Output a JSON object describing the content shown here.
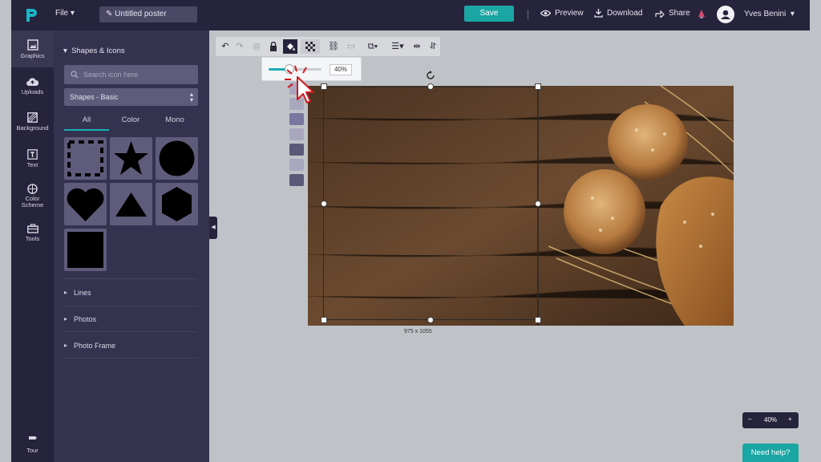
{
  "app": {
    "file_menu": "File",
    "title": "Untitled poster",
    "save": "Save",
    "preview": "Preview",
    "download": "Download",
    "share": "Share",
    "user": "Yves Benini"
  },
  "rail": [
    {
      "label": "Graphics",
      "icon": "graphics-icon"
    },
    {
      "label": "Uploads",
      "icon": "cloud-upload-icon"
    },
    {
      "label": "Background",
      "icon": "background-icon"
    },
    {
      "label": "Text",
      "icon": "text-icon"
    },
    {
      "label": "Color Scheme",
      "icon": "palette-icon"
    },
    {
      "label": "Tools",
      "icon": "toolbox-icon"
    },
    {
      "label": "Tour",
      "icon": "tour-icon"
    }
  ],
  "panel": {
    "heading": "Shapes & Icons",
    "search_placeholder": "Search icon here",
    "select_value": "Shapes - Basic",
    "tabs": [
      "All",
      "Color",
      "Mono"
    ],
    "sections": [
      "Lines",
      "Photos",
      "Photo Frame"
    ],
    "shapes": [
      "dashed-square-shape",
      "star-shape",
      "circle-shape",
      "heart-shape",
      "triangle-shape",
      "hexagon-shape",
      "square-shape"
    ]
  },
  "toolbar": {
    "opacity_value": "40%",
    "opacity_fraction": 0.4
  },
  "canvas": {
    "selection_dims": "975 x 1055"
  },
  "zoom": {
    "minus": "–",
    "value": "40%",
    "plus": "+"
  },
  "help": "Need help?",
  "colors": {
    "accent": "#1aa6a3",
    "dark": "#26233c",
    "panel": "#353250"
  }
}
